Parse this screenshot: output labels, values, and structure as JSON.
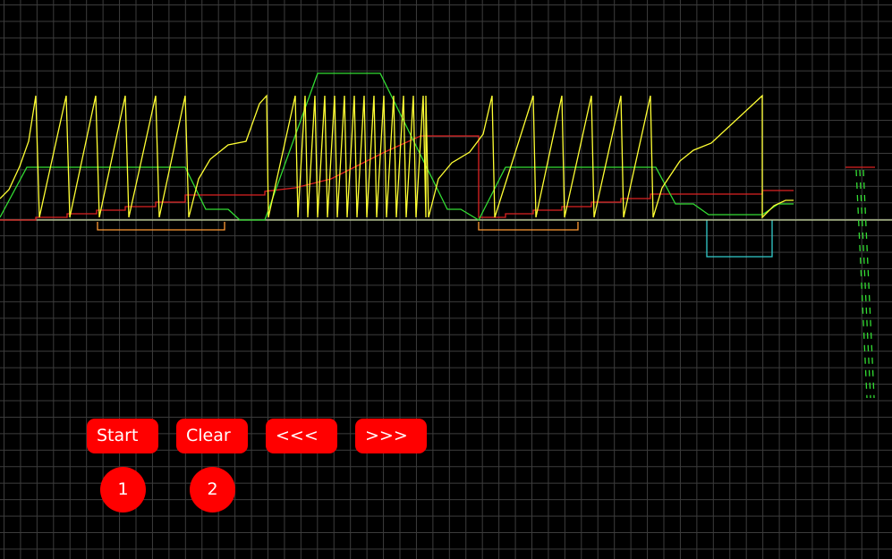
{
  "controls": {
    "start_label": "Start",
    "clear_label": "Clear",
    "prev_label": "<<<",
    "next_label": ">>>"
  },
  "badges": {
    "first": "1",
    "second": "2"
  },
  "colors": {
    "background": "#000000",
    "grid": "#3c3c3c",
    "button": "#ff0000",
    "button_text": "#ffffff",
    "trace_yellow": "#ffff33",
    "trace_green": "#33dd33",
    "trace_red": "#dd2222",
    "baseline": "#c8d8a0",
    "orange_marker": "#ff9933",
    "cyan_marker": "#33cccc"
  },
  "chart_data": {
    "type": "line",
    "title": "",
    "xlabel": "",
    "ylabel": "",
    "grid": true,
    "series": [
      {
        "color": "yellow",
        "shape": "sawtooth with flat-top ramps"
      },
      {
        "color": "green",
        "shape": "trapezoid envelope"
      },
      {
        "color": "red",
        "shape": "step"
      }
    ]
  }
}
